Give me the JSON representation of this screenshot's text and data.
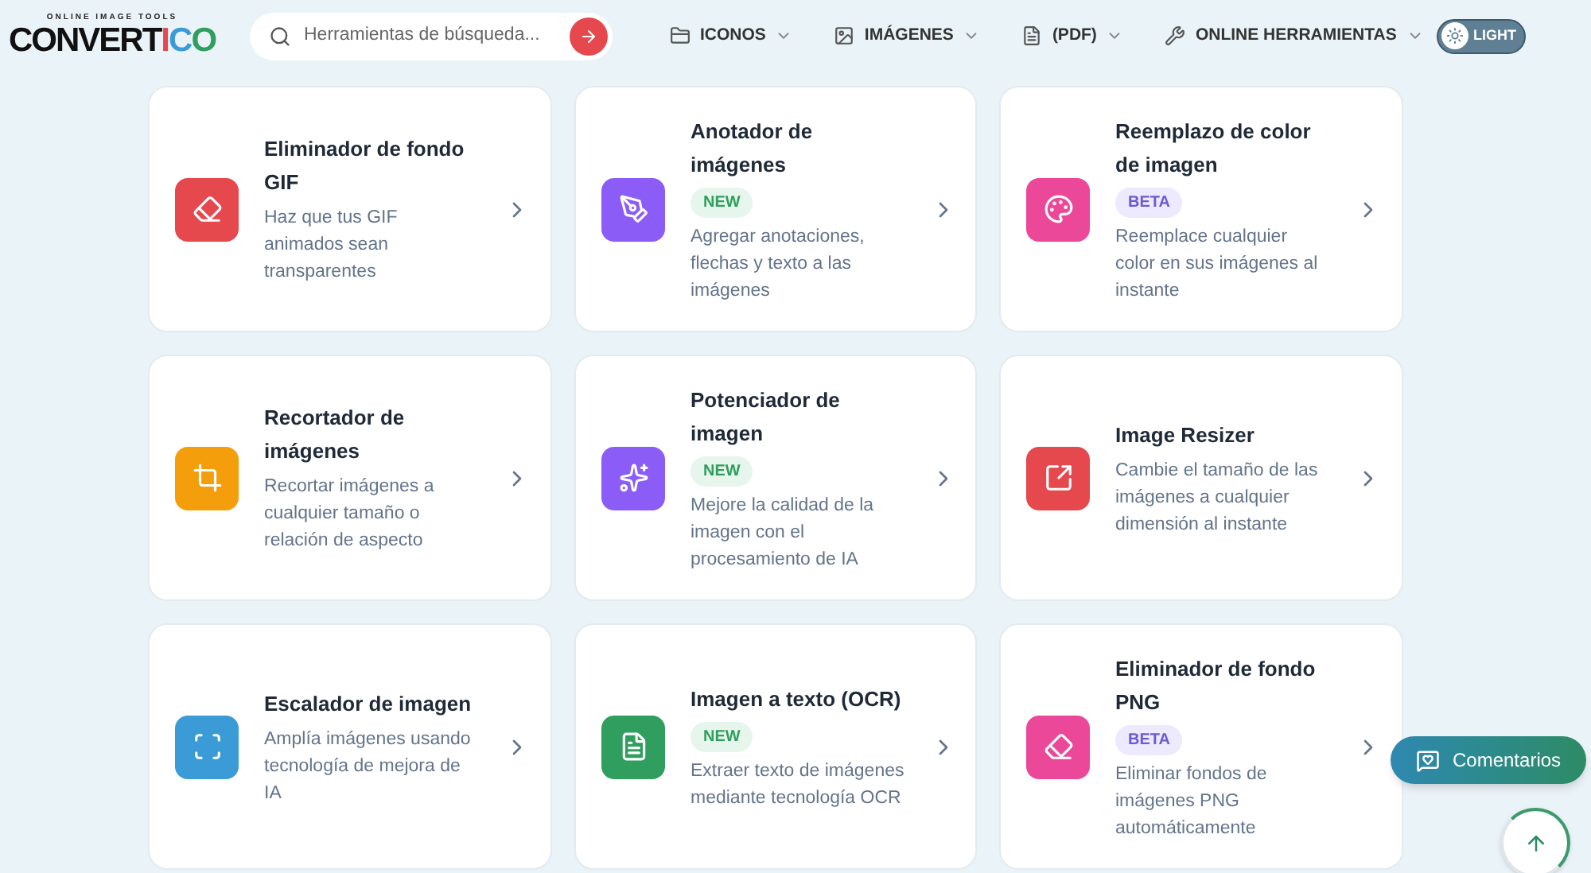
{
  "logo": {
    "tagline": "ONLINE IMAGE TOOLS",
    "main": "CONVERT",
    "accent": "ICO"
  },
  "search": {
    "placeholder": "Herramientas de búsqueda..."
  },
  "nav": [
    {
      "label": "ICONOS"
    },
    {
      "label": "IMÁGENES"
    },
    {
      "label": "(PDF)"
    },
    {
      "label": "ONLINE HERRAMIENTAS"
    }
  ],
  "theme_toggle": {
    "label": "LIGHT"
  },
  "tools": [
    {
      "title": "Eliminador de fondo GIF",
      "description": "Haz que tus GIF animados sean transparentes",
      "color": "#e5484d"
    },
    {
      "title": "Anotador de imágenes",
      "badge": {
        "kind": "new",
        "text": "NEW"
      },
      "description": "Agregar anotaciones, flechas y texto a las imágenes",
      "color": "#8b5cf6"
    },
    {
      "title": "Reemplazo de color de imagen",
      "badge": {
        "kind": "beta",
        "text": "BETA"
      },
      "description": "Reemplace cualquier color en sus imágenes al instante",
      "color": "#ec4899"
    },
    {
      "title": "Recortador de imágenes",
      "description": "Recortar imágenes a cualquier tamaño o relación de aspecto",
      "color": "#f59e0b"
    },
    {
      "title": "Potenciador de imagen",
      "badge": {
        "kind": "new",
        "text": "NEW"
      },
      "description": "Mejore la calidad de la imagen con el procesamiento de IA",
      "color": "#8b5cf6"
    },
    {
      "title": "Image Resizer",
      "description": "Cambie el tamaño de las imágenes a cualquier dimensión al instante",
      "color": "#e5484d"
    },
    {
      "title": "Escalador de imagen",
      "description": "Amplía imágenes usando tecnología de mejora de IA",
      "color": "#3b9bd6"
    },
    {
      "title": "Imagen a texto (OCR)",
      "badge": {
        "kind": "new",
        "text": "NEW"
      },
      "description": "Extraer texto de imágenes mediante tecnología OCR",
      "color": "#2f9e5f"
    },
    {
      "title": "Eliminador de fondo PNG",
      "badge": {
        "kind": "beta",
        "text": "BETA"
      },
      "description": "Eliminar fondos de imágenes PNG automáticamente",
      "color": "#ec4899"
    }
  ],
  "feedback_button": {
    "label": "Comentarios"
  }
}
